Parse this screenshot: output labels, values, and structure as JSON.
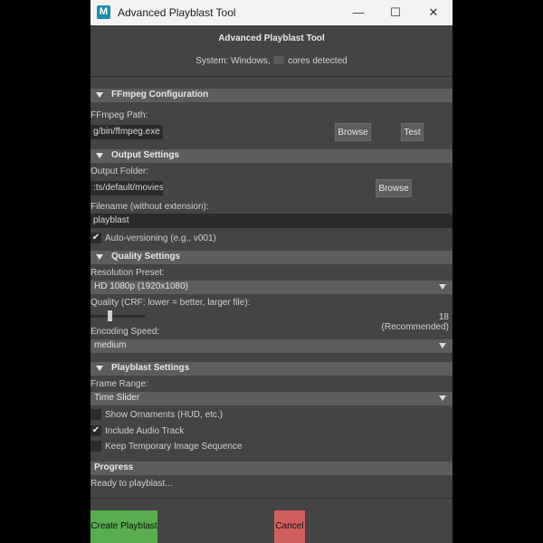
{
  "window": {
    "title": "Advanced Playblast Tool",
    "app_icon_glyph": "M",
    "minimize_glyph": "—",
    "maximize_glyph": "☐",
    "close_glyph": "✕"
  },
  "header": {
    "title": "Advanced Playblast Tool",
    "system_prefix": "System: Windows,",
    "system_suffix": "cores detected"
  },
  "ffmpeg": {
    "section_title": "FFmpeg Configuration",
    "path_label": "FFmpeg Path:",
    "path_value": "g/bin/ffmpeg.exe",
    "browse_label": "Browse",
    "test_label": "Test"
  },
  "output": {
    "section_title": "Output Settings",
    "folder_label": "Output Folder:",
    "folder_value": ":ts/default/movies",
    "browse_label": "Browse",
    "filename_label": "Filename (without extension):",
    "filename_value": "playblast",
    "auto_version_label": "Auto-versioning (e.g., v001)",
    "auto_version_checked": true
  },
  "quality": {
    "section_title": "Quality Settings",
    "resolution_label": "Resolution Preset:",
    "resolution_value": "HD 1080p (1920x1080)",
    "crf_label": "Quality (CRF: lower = better, larger file):",
    "crf_value": 18,
    "crf_display": "18 (Recommended)",
    "crf_min": 0,
    "crf_max": 51,
    "speed_label": "Encoding Speed:",
    "speed_value": "medium"
  },
  "playblast": {
    "section_title": "Playblast Settings",
    "frame_range_label": "Frame Range:",
    "frame_range_value": "Time Slider",
    "show_ornaments_label": "Show Ornaments (HUD, etc.)",
    "show_ornaments_checked": false,
    "include_audio_label": "Include Audio Track",
    "include_audio_checked": true,
    "keep_temp_label": "Keep Temporary Image Sequence",
    "keep_temp_checked": false
  },
  "progress": {
    "section_title": "Progress",
    "status": "Ready to playblast..."
  },
  "footer": {
    "create_label": "Create Playblast",
    "cancel_label": "Cancel"
  },
  "check_glyph": "✔",
  "colors": {
    "panel_bg": "#444444",
    "section_bg": "#5d5d5d",
    "field_bg": "#2b2b2b",
    "create_button": "#58ad4f",
    "cancel_button": "#d05e5c"
  }
}
